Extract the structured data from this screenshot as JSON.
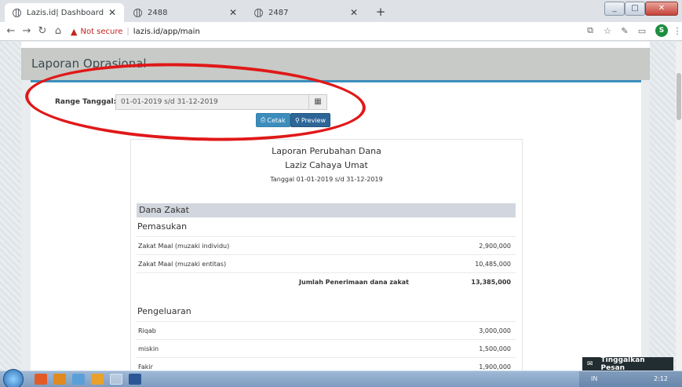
{
  "browser": {
    "tabs": [
      {
        "title": "Lazis.id| Dashboard",
        "active": true
      },
      {
        "title": "2488",
        "active": false
      },
      {
        "title": "2487",
        "active": false
      }
    ],
    "security_label": "Not secure",
    "url": "lazis.id/app/main",
    "profile_initial": "S"
  },
  "page": {
    "title": "Laporan Oprasional",
    "range_label": "Range Tanggal:",
    "range_value": "01-01-2019 s/d 31-12-2019",
    "btn_cetak": "Cetak",
    "btn_preview": "Preview"
  },
  "report": {
    "title": "Laporan Perubahan Dana",
    "org": "Laziz Cahaya Umat",
    "period": "Tanggal 01-01-2019 s/d 31-12-2019",
    "section": "Dana Zakat",
    "pemasukan_label": "Pemasukan",
    "pemasukan_rows": [
      {
        "label": "Zakat Maal (muzaki individu)",
        "value": "2,900,000"
      },
      {
        "label": "Zakat Maal (muzaki entitas)",
        "value": "10,485,000"
      }
    ],
    "total_label": "Jumlah Penerimaan dana zakat",
    "total_value": "13,385,000",
    "pengeluaran_label": "Pengeluaran",
    "pengeluaran_rows": [
      {
        "label": "Riqab",
        "value": "3,000,000"
      },
      {
        "label": "miskin",
        "value": "1,500,000"
      },
      {
        "label": "Fakir",
        "value": "1,900,000"
      }
    ]
  },
  "chat_button": "Tinggalkan Pesan",
  "taskbar": {
    "lang": "IN",
    "time": "2:12"
  },
  "colors": {
    "accent": "#3c8dbc",
    "annotation": "#e01818"
  }
}
